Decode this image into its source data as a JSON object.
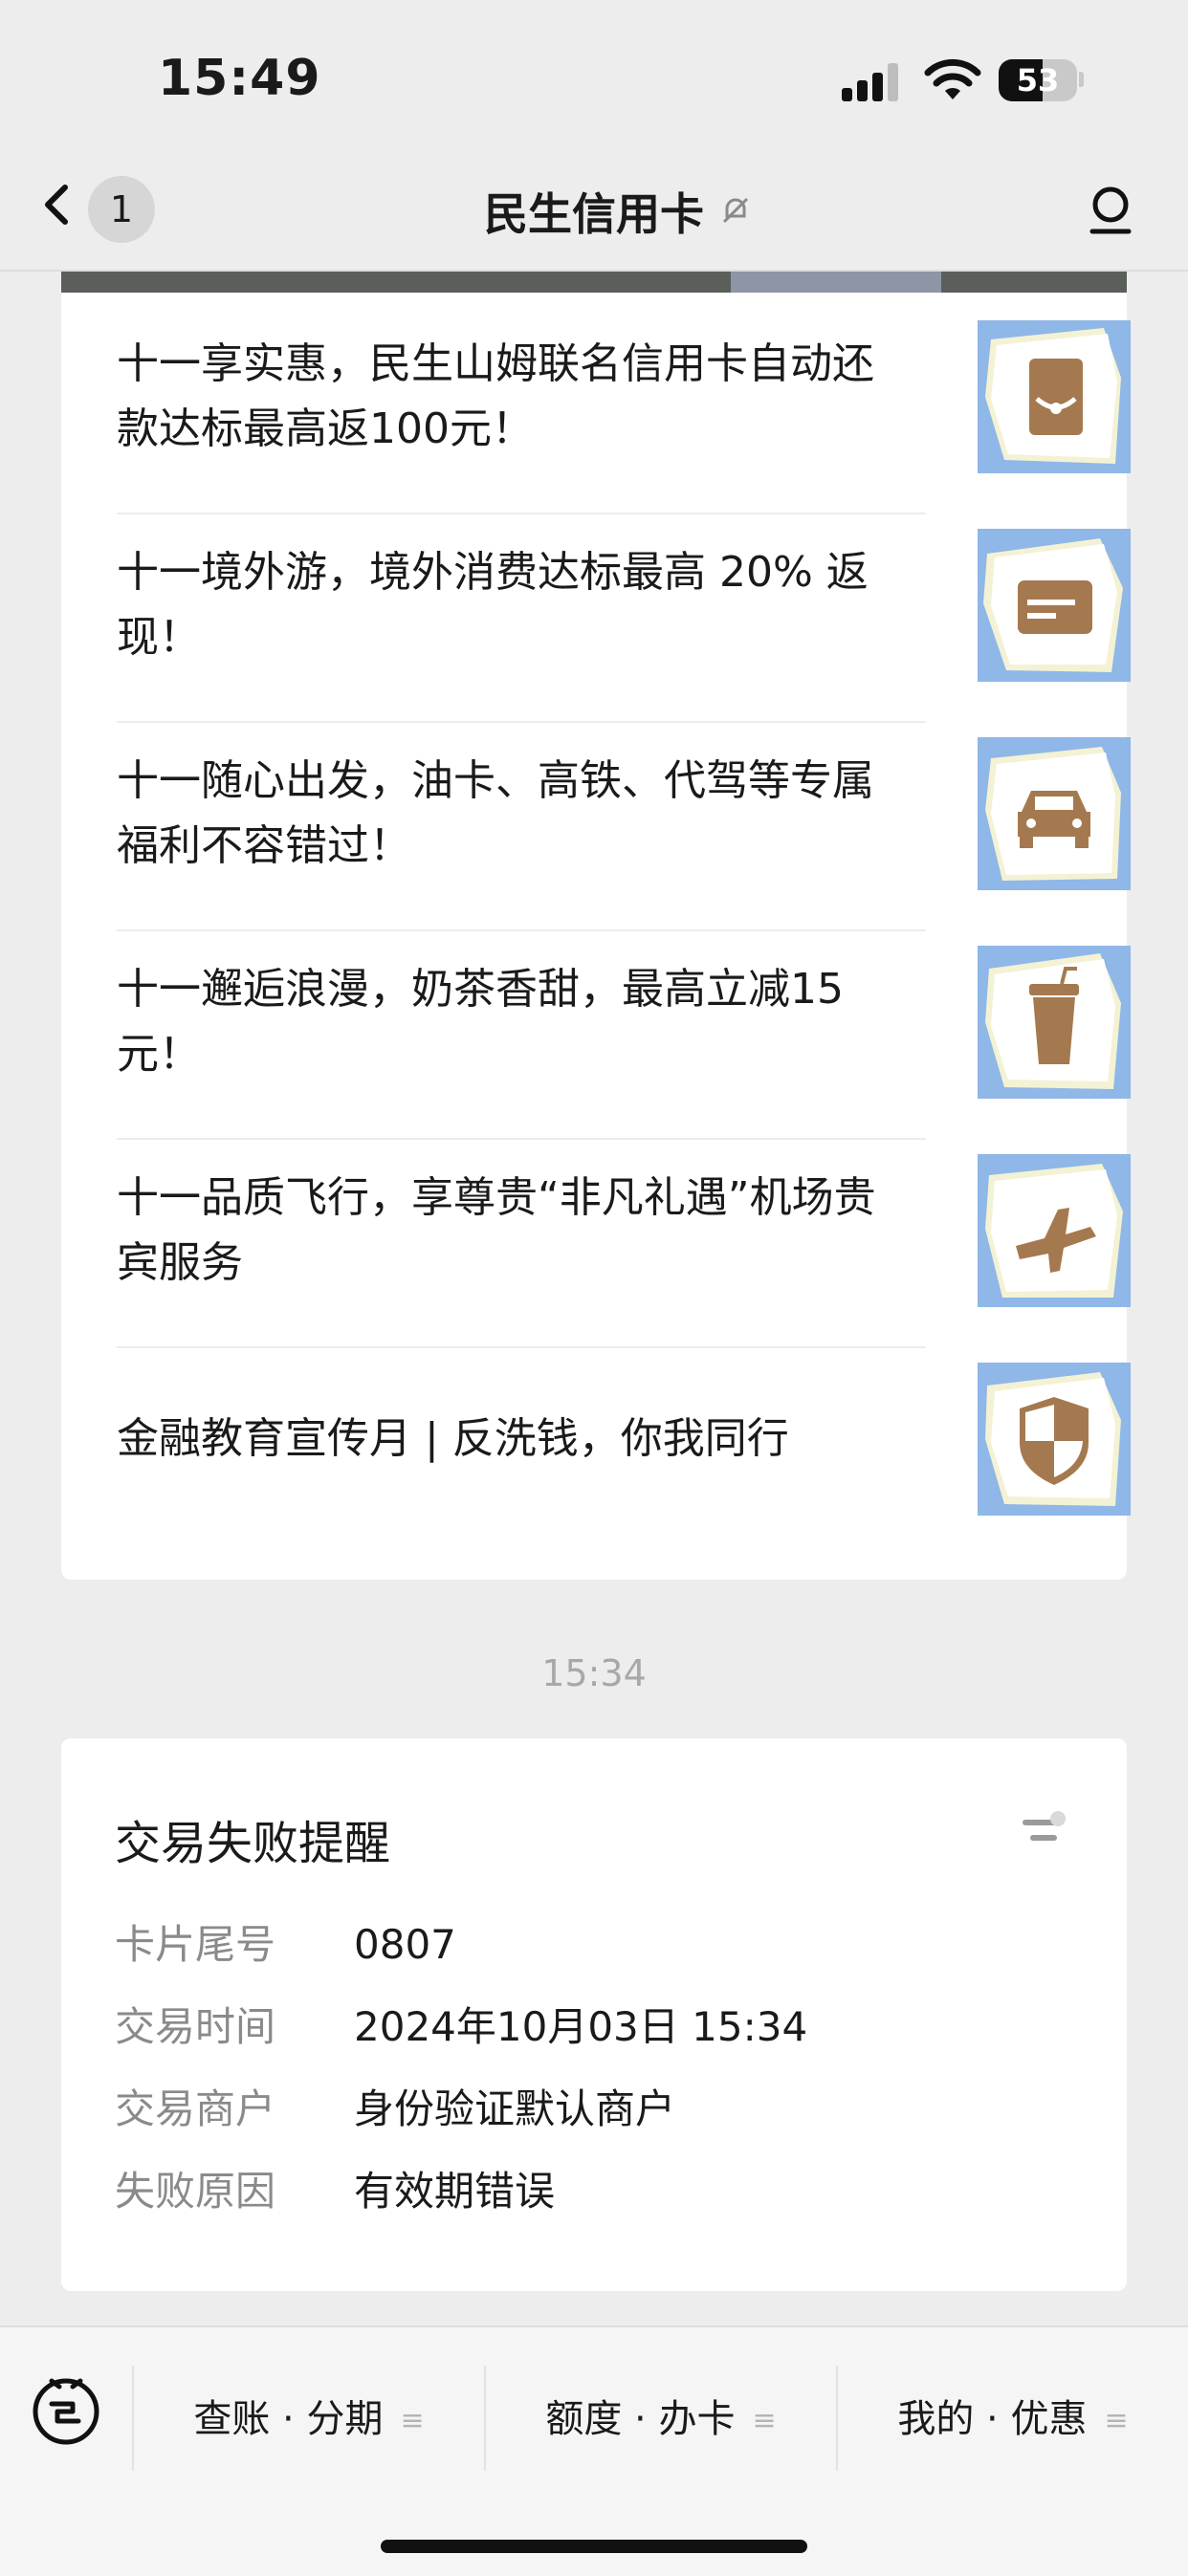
{
  "status_bar": {
    "time": "15:49",
    "battery": "53"
  },
  "nav": {
    "back_badge": "1",
    "title": "民生信用卡"
  },
  "articles": [
    {
      "text": "十一享实惠，民生山姆联名信用卡自动还款达标最高返100元！",
      "icon": "card-bag-icon"
    },
    {
      "text": "十一境外游，境外消费达标最高 20% 返现！",
      "icon": "credit-card-icon"
    },
    {
      "text": "十一随心出发，油卡、高铁、代驾等专属福利不容错过！",
      "icon": "car-icon"
    },
    {
      "text": "十一邂逅浪漫，奶茶香甜，最高立减15元！",
      "icon": "drink-cup-icon"
    },
    {
      "text": "十一品质飞行，享尊贵“非凡礼遇”机场贵宾服务",
      "icon": "airplane-icon"
    },
    {
      "text": "金融教育宣传月 | 反洗钱，你我同行",
      "icon": "shield-icon"
    }
  ],
  "timestamp": "15:34",
  "notice": {
    "title": "交易失败提醒",
    "rows": [
      {
        "label": "卡片尾号",
        "value": "0807"
      },
      {
        "label": "交易时间",
        "value": "2024年10月03日 15:34"
      },
      {
        "label": "交易商户",
        "value": "身份验证默认商户"
      },
      {
        "label": "失败原因",
        "value": "有效期错误"
      }
    ]
  },
  "bottom_menu": [
    "查账 · 分期",
    "额度 · 办卡",
    "我的 · 优惠"
  ],
  "colors": {
    "thumb_bg": "#8fb7e8",
    "icon_brown": "#a5794f",
    "accent_yellow": "#e8e3a4"
  }
}
